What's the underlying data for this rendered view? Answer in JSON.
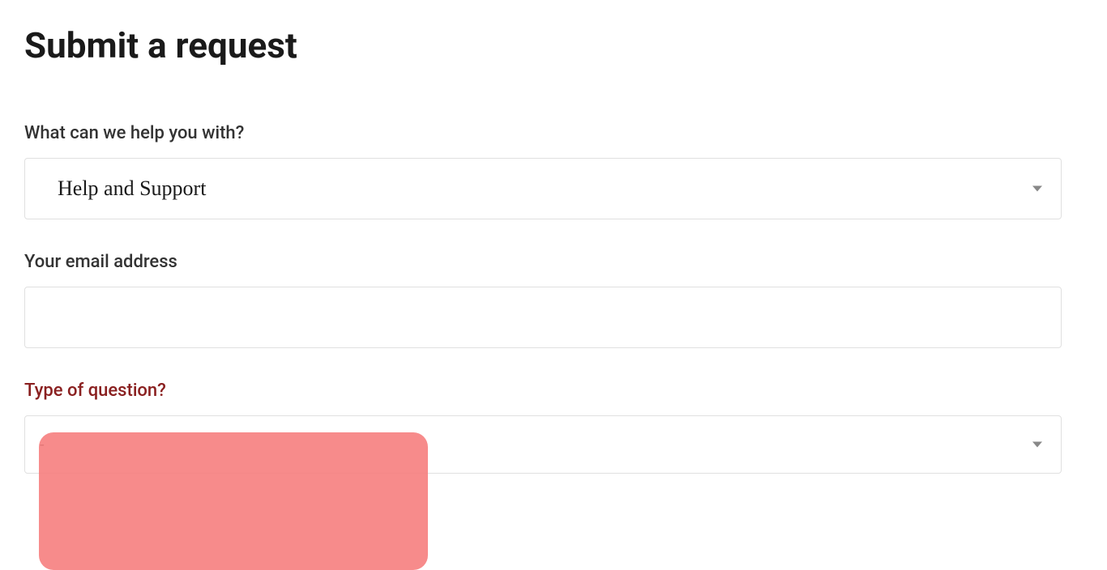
{
  "page": {
    "title": "Submit a request"
  },
  "form": {
    "help_topic": {
      "label": "What can we help you with?",
      "selected": "Help and Support"
    },
    "email": {
      "label": "Your email address",
      "value": ""
    },
    "question_type": {
      "label": "Type of question?",
      "selected": "-"
    }
  }
}
